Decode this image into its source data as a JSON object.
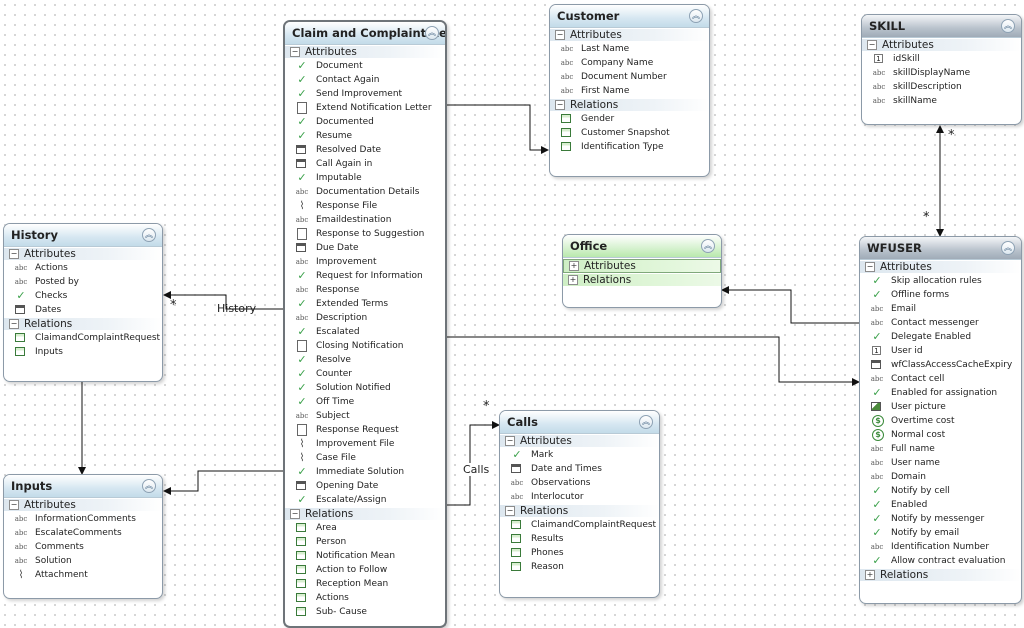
{
  "entities": {
    "claim": {
      "title": "Claim and Complaint Re",
      "attributes_label": "Attributes",
      "relations_label": "Relations",
      "attributes": [
        {
          "label": "Document",
          "icon": "check"
        },
        {
          "label": "Contact Again",
          "icon": "check"
        },
        {
          "label": "Send Improvement",
          "icon": "check"
        },
        {
          "label": "Extend Notification Letter",
          "icon": "doc"
        },
        {
          "label": "Documented",
          "icon": "check"
        },
        {
          "label": "Resume",
          "icon": "check"
        },
        {
          "label": "Resolved Date",
          "icon": "cal"
        },
        {
          "label": "Call Again in",
          "icon": "cal"
        },
        {
          "label": "Imputable",
          "icon": "check"
        },
        {
          "label": "Documentation Details",
          "icon": "abc"
        },
        {
          "label": "Response File",
          "icon": "clip"
        },
        {
          "label": "Emaildestination",
          "icon": "abc"
        },
        {
          "label": "Response to Suggestion",
          "icon": "doc"
        },
        {
          "label": "Due Date",
          "icon": "cal"
        },
        {
          "label": "Improvement",
          "icon": "abc"
        },
        {
          "label": "Request for Information",
          "icon": "check"
        },
        {
          "label": "Response",
          "icon": "abc"
        },
        {
          "label": "Extended Terms",
          "icon": "check"
        },
        {
          "label": "Description",
          "icon": "abc"
        },
        {
          "label": "Escalated",
          "icon": "check"
        },
        {
          "label": "Closing Notification",
          "icon": "doc"
        },
        {
          "label": "Resolve",
          "icon": "check"
        },
        {
          "label": "Counter",
          "icon": "check"
        },
        {
          "label": "Solution Notified",
          "icon": "check"
        },
        {
          "label": "Off Time",
          "icon": "check"
        },
        {
          "label": "Subject",
          "icon": "abc"
        },
        {
          "label": "Response Request",
          "icon": "doc"
        },
        {
          "label": "Improvement File",
          "icon": "clip"
        },
        {
          "label": "Case File",
          "icon": "clip"
        },
        {
          "label": "Immediate Solution",
          "icon": "check"
        },
        {
          "label": "Opening Date",
          "icon": "cal"
        },
        {
          "label": "Escalate/Assign",
          "icon": "check"
        }
      ],
      "relations": [
        {
          "label": "Area",
          "icon": "table"
        },
        {
          "label": "Person",
          "icon": "table"
        },
        {
          "label": "Notification Mean",
          "icon": "table"
        },
        {
          "label": "Action to Follow",
          "icon": "table"
        },
        {
          "label": "Reception Mean",
          "icon": "table"
        },
        {
          "label": "Actions",
          "icon": "table"
        },
        {
          "label": "Sub- Cause",
          "icon": "table"
        }
      ]
    },
    "customer": {
      "title": "Customer",
      "attributes_label": "Attributes",
      "relations_label": "Relations",
      "attributes": [
        {
          "label": "Last Name",
          "icon": "abc"
        },
        {
          "label": "Company Name",
          "icon": "abc"
        },
        {
          "label": "Document Number",
          "icon": "abc"
        },
        {
          "label": "First Name",
          "icon": "abc"
        }
      ],
      "relations": [
        {
          "label": "Gender",
          "icon": "table"
        },
        {
          "label": "Customer Snapshot",
          "icon": "table"
        },
        {
          "label": "Identification Type",
          "icon": "table"
        }
      ]
    },
    "skill": {
      "title": "SKILL",
      "attributes_label": "Attributes",
      "attributes": [
        {
          "label": "idSkill",
          "icon": "num"
        },
        {
          "label": "skillDisplayName",
          "icon": "abc"
        },
        {
          "label": "skillDescription",
          "icon": "abc"
        },
        {
          "label": "skillName",
          "icon": "abc"
        }
      ]
    },
    "history": {
      "title": "History",
      "attributes_label": "Attributes",
      "relations_label": "Relations",
      "attributes": [
        {
          "label": "Actions",
          "icon": "abc"
        },
        {
          "label": "Posted by",
          "icon": "abc"
        },
        {
          "label": "Checks",
          "icon": "check"
        },
        {
          "label": "Dates",
          "icon": "cal"
        }
      ],
      "relations": [
        {
          "label": "ClaimandComplaintRequest",
          "icon": "table"
        },
        {
          "label": "Inputs",
          "icon": "table"
        }
      ]
    },
    "office": {
      "title": "Office",
      "attributes_label": "Attributes",
      "relations_label": "Relations"
    },
    "wfuser": {
      "title": "WFUSER",
      "attributes_label": "Attributes",
      "relations_label": "Relations",
      "attributes": [
        {
          "label": "Skip allocation rules",
          "icon": "check"
        },
        {
          "label": "Offline forms",
          "icon": "check"
        },
        {
          "label": "Email",
          "icon": "abc"
        },
        {
          "label": "Contact messenger",
          "icon": "abc"
        },
        {
          "label": "Delegate Enabled",
          "icon": "check"
        },
        {
          "label": "User id",
          "icon": "num"
        },
        {
          "label": "wfClassAccessCacheExpiry",
          "icon": "cal"
        },
        {
          "label": "Contact cell",
          "icon": "abc"
        },
        {
          "label": "Enabled for assignation",
          "icon": "check"
        },
        {
          "label": "User picture",
          "icon": "pic"
        },
        {
          "label": "Overtime cost",
          "icon": "money"
        },
        {
          "label": "Normal cost",
          "icon": "money"
        },
        {
          "label": "Full name",
          "icon": "abc"
        },
        {
          "label": "User name",
          "icon": "abc"
        },
        {
          "label": "Domain",
          "icon": "abc"
        },
        {
          "label": "Notify by cell",
          "icon": "check"
        },
        {
          "label": "Enabled",
          "icon": "check"
        },
        {
          "label": "Notify by messenger",
          "icon": "check"
        },
        {
          "label": "Notify by email",
          "icon": "check"
        },
        {
          "label": "Identification Number",
          "icon": "abc"
        },
        {
          "label": "Allow contract evaluation",
          "icon": "check"
        }
      ]
    },
    "calls": {
      "title": "Calls",
      "attributes_label": "Attributes",
      "relations_label": "Relations",
      "attributes": [
        {
          "label": "Mark",
          "icon": "check"
        },
        {
          "label": "Date and Times",
          "icon": "cal"
        },
        {
          "label": "Observations",
          "icon": "abc"
        },
        {
          "label": "Interlocutor",
          "icon": "abc"
        }
      ],
      "relations": [
        {
          "label": "ClaimandComplaintRequest",
          "icon": "table"
        },
        {
          "label": "Results",
          "icon": "table"
        },
        {
          "label": "Phones",
          "icon": "table"
        },
        {
          "label": "Reason",
          "icon": "table"
        }
      ]
    },
    "inputs": {
      "title": "Inputs",
      "attributes_label": "Attributes",
      "attributes": [
        {
          "label": "InformationComments",
          "icon": "abc"
        },
        {
          "label": "EscalateComments",
          "icon": "abc"
        },
        {
          "label": "Comments",
          "icon": "abc"
        },
        {
          "label": "Solution",
          "icon": "abc"
        },
        {
          "label": "Attachment",
          "icon": "clip"
        }
      ]
    }
  },
  "connections": {
    "history_label": "History",
    "calls_label": "Calls",
    "many_symbol": "*"
  },
  "icons": {
    "collapse": "chevrons-up-icon",
    "expanded": "minus-icon",
    "collapsed": "plus-icon"
  }
}
